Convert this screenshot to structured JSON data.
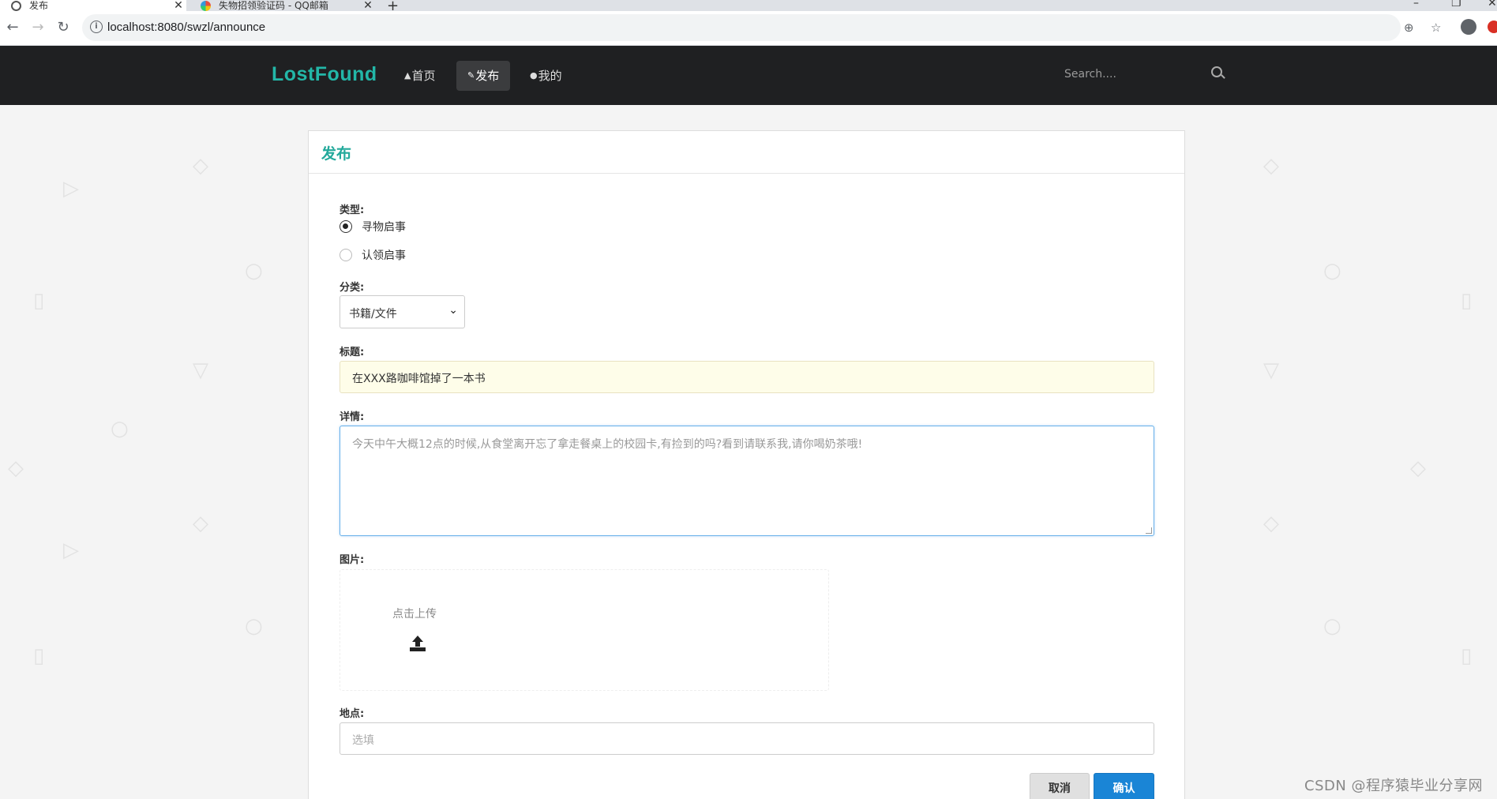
{
  "browser": {
    "tabs": [
      {
        "title": "发布",
        "active": true
      },
      {
        "title": "失物招领验证码 - QQ邮箱",
        "active": false
      }
    ],
    "url": "localhost:8080/swzl/announce",
    "icons": [
      "back-icon",
      "forward-icon",
      "reload-icon",
      "info-icon",
      "zoom-icon",
      "star-icon",
      "account-icon"
    ]
  },
  "navbar": {
    "brand": "LostFound",
    "items": [
      {
        "label": "首页",
        "icon": "home-icon",
        "active": false
      },
      {
        "label": "发布",
        "icon": "edit-icon",
        "active": true
      },
      {
        "label": "我的",
        "icon": "user-icon",
        "active": false
      }
    ],
    "search_placeholder": "Search...."
  },
  "form": {
    "title": "发布",
    "type_label": "类型:",
    "type_options": [
      {
        "label": "寻物启事",
        "checked": true
      },
      {
        "label": "认领启事",
        "checked": false
      }
    ],
    "category_label": "分类:",
    "category_value": "书籍/文件",
    "title_label": "标题:",
    "title_value": "在XXX路咖啡馆掉了一本书",
    "detail_label": "详情:",
    "detail_placeholder": "今天中午大概12点的时候,从食堂离开忘了拿走餐桌上的校园卡,有捡到的吗?看到请联系我,请你喝奶茶哦!",
    "image_label": "图片:",
    "upload_text": "点击上传",
    "location_label": "地点:",
    "location_placeholder": "选填",
    "cancel_label": "取消",
    "confirm_label": "确认"
  },
  "watermark": "CSDN @程序猿毕业分享网",
  "colors": {
    "brand": "#23b7a8",
    "navbar_bg": "#1f2022",
    "confirm": "#1a85d6"
  }
}
